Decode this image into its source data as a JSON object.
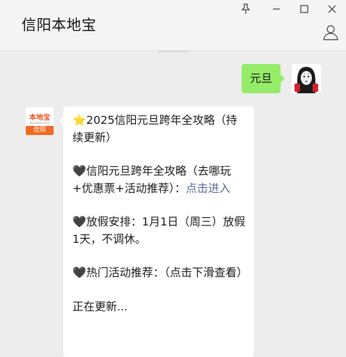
{
  "window": {
    "title": "信阳本地宝",
    "controls": [
      "pin-icon",
      "minimize-icon",
      "maximize-icon",
      "close-icon"
    ]
  },
  "messages": [
    {
      "sender": "me",
      "text": "元旦",
      "bubble_color": "#95ec69"
    },
    {
      "sender": "bot",
      "avatar": {
        "logo_text": "本地宝",
        "logo_sub": "Bendibao.com",
        "city": "信阳"
      },
      "paragraphs": [
        {
          "text": "⭐2025信阳元旦跨年全攻略（持续更新）"
        },
        {
          "text": "🖤信阳元旦跨年全攻略（去哪玩+优惠票+活动推荐）：",
          "link": "点击进入"
        },
        {
          "text": "🖤放假安排：1月1日（周三）放假1天，不调休。"
        },
        {
          "text": "🖤热门活动推荐：（点击下滑查看）"
        },
        {
          "text": "正在更新..."
        }
      ]
    }
  ],
  "colors": {
    "link": "#576b95",
    "background": "#ededed",
    "accent_orange": "#f06a22"
  }
}
